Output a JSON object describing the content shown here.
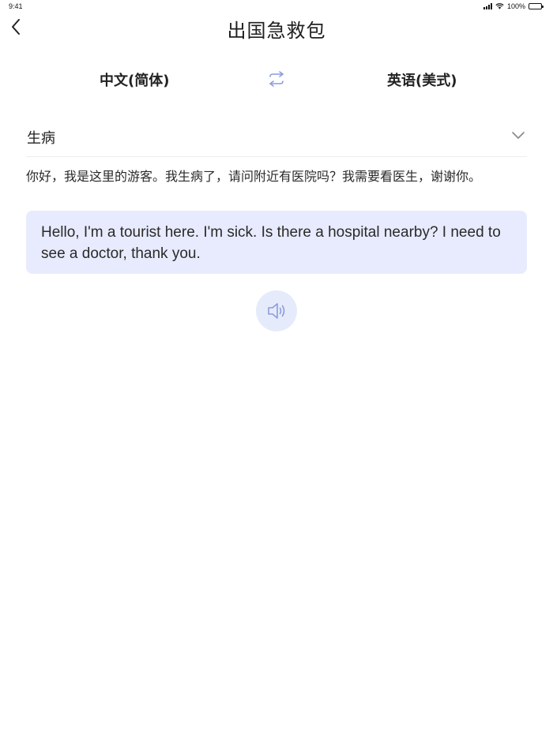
{
  "status_bar": {
    "time": "9:41",
    "battery": "100%"
  },
  "header": {
    "title": "出国急救包",
    "back_icon": "chevron-left-icon"
  },
  "languages": {
    "source": "中文(简体)",
    "target": "英语(美式)",
    "swap_icon": "swap-arrows-icon"
  },
  "category": {
    "label": "生病",
    "dropdown_icon": "chevron-down-icon"
  },
  "phrase": {
    "source_text": "你好，我是这里的游客。我生病了，请问附近有医院吗？我需要看医生，谢谢你。",
    "translation": "Hello, I'm a tourist here. I'm sick. Is there a hospital nearby? I need to see a doctor, thank you."
  },
  "speak_icon": "speaker-icon",
  "colors": {
    "card_bg": "#e8ebfd",
    "accent": "#8c9cde",
    "speak_button_bg": "#e6ebfb"
  }
}
